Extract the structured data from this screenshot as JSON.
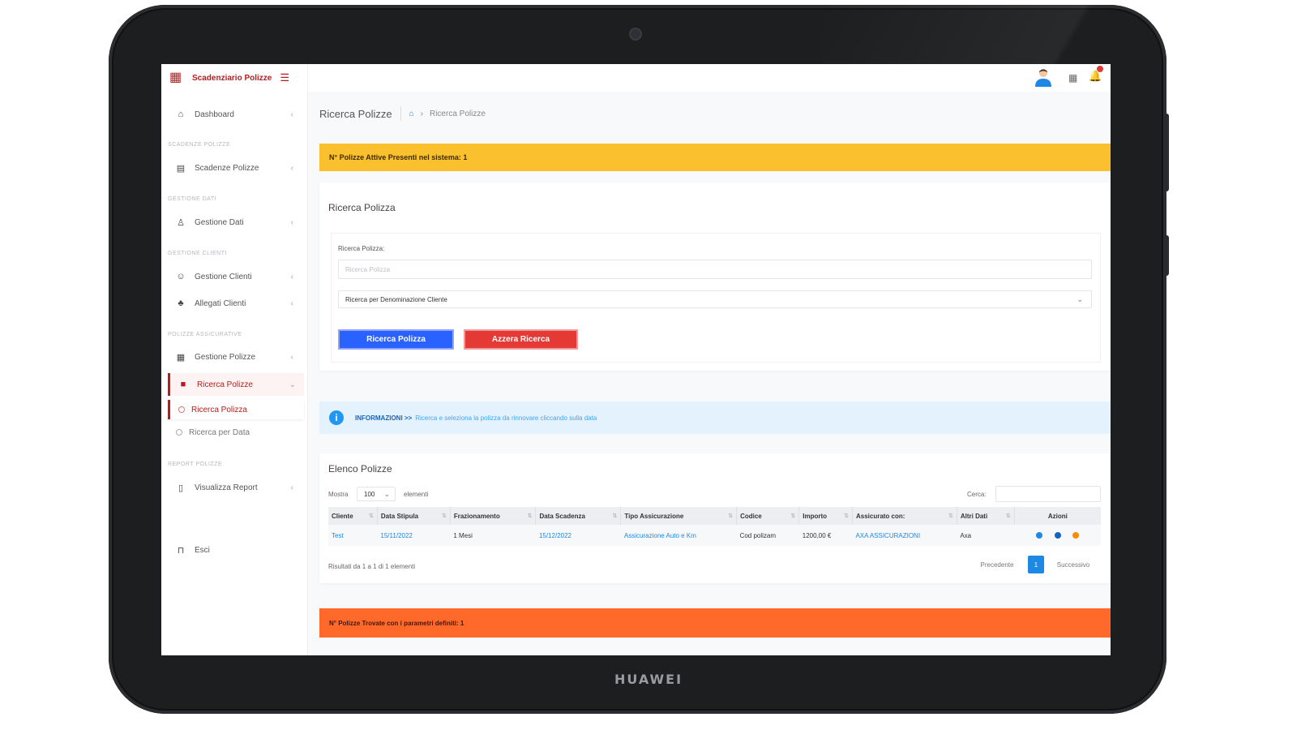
{
  "device": {
    "brand": "HUAWEI"
  },
  "sidebar": {
    "logo_text": "Scadenziario Polizze",
    "items": [
      {
        "label": "Dashboard"
      },
      {
        "label": "Scadenze Polizze"
      },
      {
        "label": "Gestione Dati"
      },
      {
        "label": "Gestione Clienti"
      },
      {
        "label": "Allegati Clienti"
      },
      {
        "label": "Gestione Polizze"
      },
      {
        "label": "Ricerca Polizze"
      },
      {
        "label": "Visualizza Report"
      },
      {
        "label": "Esci"
      }
    ],
    "sections": [
      "SCADENZE POLIZZE",
      "GESTIONE DATI",
      "GESTIONE CLIENTI",
      "POLIZZE ASSICURATIVE",
      "REPORT POLIZZE"
    ],
    "subitems": [
      {
        "label": "Ricerca Polizza"
      },
      {
        "label": "Ricerca per Data"
      }
    ]
  },
  "header": {
    "page_title": "Ricerca Polizze",
    "breadcrumb": "Ricerca Polizze"
  },
  "alerts": {
    "yellow": "N° Polizze Attive Presenti nel sistema: 1",
    "info_strong": "INFORMAZIONI >>",
    "info_text": "Ricerca e seleziona la polizza da rinnovare cliccando sulla data",
    "orange": "N° Polizze Trovate con i parametri definiti: 1"
  },
  "search": {
    "card_title": "Ricerca Polizza",
    "field_label": "Ricerca Polizza:",
    "placeholder": "Ricerca Polizza",
    "select_value": "Ricerca per Denominazione Cliente",
    "search_button": "Ricerca Polizza",
    "reset_button": "Azzera Ricerca"
  },
  "list": {
    "title": "Elenco Polizze",
    "show_label": "Mostra",
    "page_size": "100",
    "elements_label": "elementi",
    "search_label": "Cerca:",
    "columns": [
      "Cliente",
      "Data Stipula",
      "Frazionamento",
      "Data Scadenza",
      "Tipo Assicurazione",
      "Codice",
      "Importo",
      "Assicurato con:",
      "Altri Dati",
      "Azioni"
    ],
    "rows": [
      {
        "cliente": "Test",
        "data_stipula": "15/11/2022",
        "frazionamento": "1 Mesi",
        "data_scadenza": "15/12/2022",
        "tipo": "Assicurazione Auto e Km",
        "codice": "Cod polizam",
        "importo": "1200,00 €",
        "assicurato": "AXA ASSICURAZIONI",
        "altri": "Axa"
      }
    ],
    "footer_text": "Risultati da 1 a 1 di 1 elementi",
    "prev": "Precedente",
    "page": "1",
    "next": "Successivo"
  },
  "colors": {
    "brand": "#b71c1c",
    "yellow": "#fbc02d",
    "orange": "#ff6a2b",
    "blue": "#2962ff",
    "red": "#e53935",
    "info": "#e3f2fd"
  }
}
